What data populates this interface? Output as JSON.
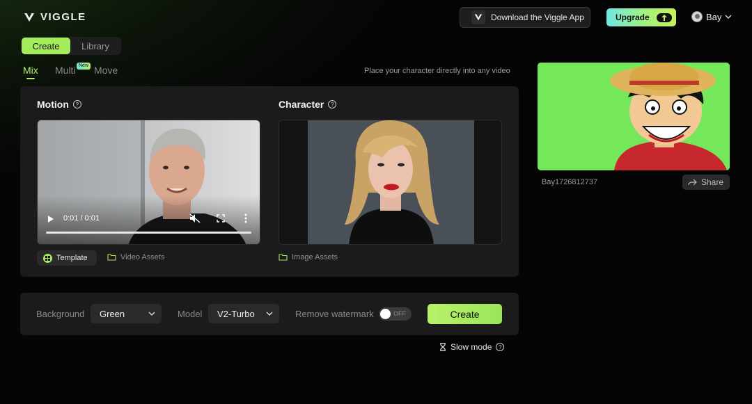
{
  "header": {
    "logo_text": "VIGGLE",
    "download_label": "Download the Viggle App",
    "upgrade_label": "Upgrade",
    "user_name": "Bay"
  },
  "top_tabs": [
    {
      "label": "Create",
      "active": true
    },
    {
      "label": "Library",
      "active": false
    }
  ],
  "modes": [
    {
      "label": "Mix",
      "active": true
    },
    {
      "label": "Multi",
      "badge": "New"
    },
    {
      "label": "Move"
    }
  ],
  "mode_hint": "Place your character directly into any video",
  "motion": {
    "title": "Motion",
    "time": "0:01 / 0:01",
    "progress": 1.0,
    "template_label": "Template",
    "assets_label": "Video Assets"
  },
  "character": {
    "title": "Character",
    "assets_label": "Image Assets"
  },
  "settings": {
    "background_label": "Background",
    "background_value": "Green",
    "model_label": "Model",
    "model_value": "V2-Turbo",
    "watermark_label": "Remove watermark",
    "watermark_state": "OFF",
    "create_label": "Create",
    "slow_mode_label": "Slow mode"
  },
  "result": {
    "id": "Bay1726812737",
    "share_label": "Share"
  },
  "colors": {
    "accent": "#a4ec5c",
    "background_green": "#74e85a",
    "panel": "#1b1b1b"
  }
}
